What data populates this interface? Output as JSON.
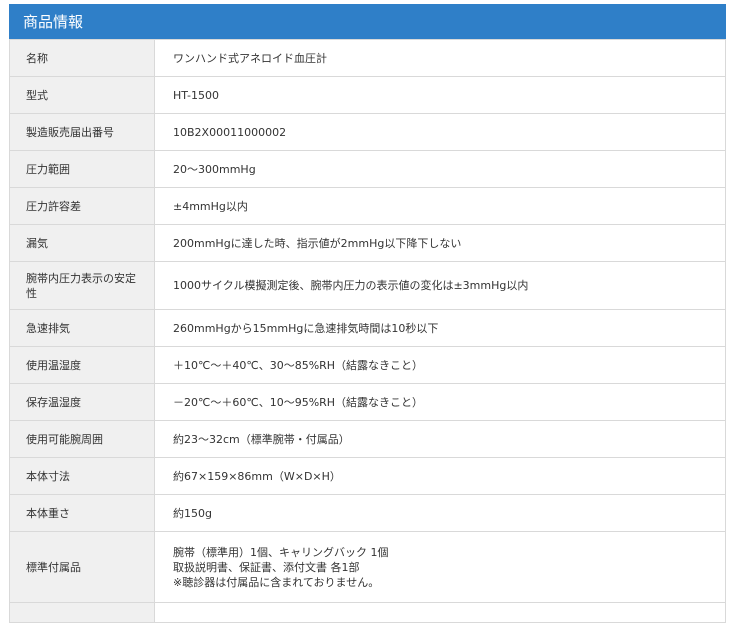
{
  "section": {
    "title": "商品情報"
  },
  "rows": [
    {
      "label": "名称",
      "value": "ワンハンド式アネロイド血圧計"
    },
    {
      "label": "型式",
      "value": "HT-1500"
    },
    {
      "label": "製造販売届出番号",
      "value": "10B2X00011000002"
    },
    {
      "label": "圧力範囲",
      "value": "20～300mmHg"
    },
    {
      "label": "圧力許容差",
      "value": "±4mmHg以内"
    },
    {
      "label": "漏気",
      "value": "200mmHgに達した時、指示値が2mmHg以下降下しない"
    },
    {
      "label": "腕帯内圧力表示の安定性",
      "value": "1000サイクル模擬測定後、腕帯内圧力の表示値の変化は±3mmHg以内"
    },
    {
      "label": "急速排気",
      "value": "260mmHgから15mmHgに急速排気時間は10秒以下"
    },
    {
      "label": "使用温湿度",
      "value": "＋10℃～＋40℃、30～85%RH（結露なきこと）"
    },
    {
      "label": "保存温湿度",
      "value": "－20℃～＋60℃、10～95%RH（結露なきこと）"
    },
    {
      "label": "使用可能腕周囲",
      "value": "約23～32cm（標準腕帯・付属品）"
    },
    {
      "label": "本体寸法",
      "value": "約67×159×86mm（W×D×H）"
    },
    {
      "label": "本体重さ",
      "value": "約150g"
    },
    {
      "label": "標準付属品",
      "lines": [
        "腕帯（標準用）1個、キャリングバック 1個",
        "取扱説明書、保証書、添付文書 各1部",
        "※聴診器は付属品に含まれておりません。"
      ]
    }
  ]
}
